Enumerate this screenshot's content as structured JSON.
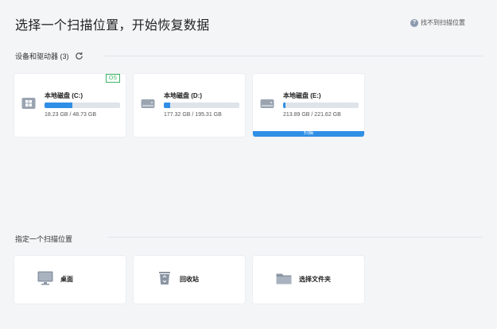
{
  "page": {
    "title": "选择一个扫描位置，开始恢复数据",
    "help_link": "找不到扫描位置"
  },
  "devices": {
    "heading": "设备和驱动器 (3)",
    "drives": [
      {
        "name": "本地磁盘 (C:)",
        "size": "18.23 GB / 48.73 GB",
        "used_fraction": 0.37,
        "badge": "OS",
        "icon": "windows-drive-icon"
      },
      {
        "name": "本地磁盘 (D:)",
        "size": "177.32 GB / 195.31 GB",
        "used_fraction": 0.08,
        "icon": "hard-drive-icon"
      },
      {
        "name": "本地磁盘 (E:)",
        "size": "213.89 GB / 221.62 GB",
        "used_fraction": 0.03,
        "icon": "hard-drive-icon",
        "hover_label": "扫描"
      }
    ]
  },
  "locations": {
    "heading": "指定一个扫描位置",
    "items": [
      {
        "name": "桌面",
        "icon": "desktop-icon"
      },
      {
        "name": "回收站",
        "icon": "recycle-bin-icon"
      },
      {
        "name": "选择文件夹",
        "icon": "folder-icon"
      }
    ]
  },
  "colors": {
    "accent": "#2f8fe6",
    "os_badge": "#3bb364",
    "background": "#f4f5f7"
  }
}
